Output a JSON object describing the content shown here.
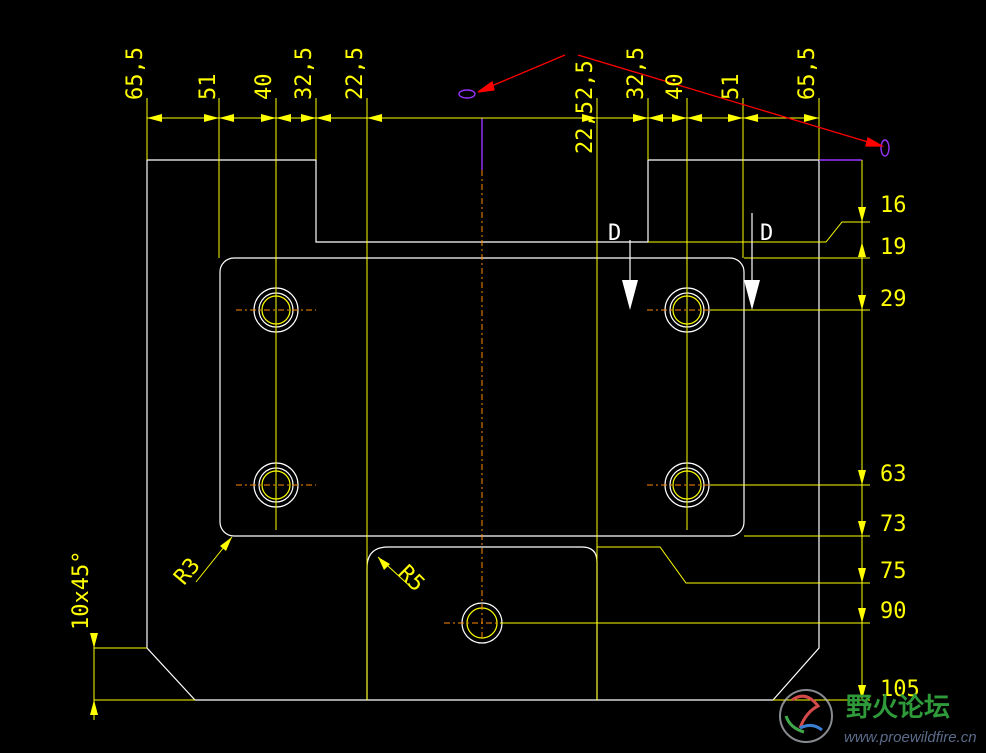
{
  "top_dimensions_left": [
    "65,5",
    "51",
    "40",
    "32,5",
    "22,5"
  ],
  "top_dimensions_right": [
    "2,5",
    "22,5",
    "32,5",
    "40",
    "51",
    "65,5"
  ],
  "right_dimensions": [
    "16",
    "19",
    "29",
    "63",
    "73",
    "75",
    "90",
    "105"
  ],
  "section_labels": [
    "D",
    "D"
  ],
  "radius_labels": [
    "R3",
    "R5"
  ],
  "chamfer_label": "10x45°",
  "watermark": {
    "name": "野火论坛",
    "url": "www.proewildfire.cn"
  },
  "colors": {
    "background": "#000000",
    "geometry": "#ffffff",
    "dimension": "#ffff00",
    "centerline": "#ff8c00",
    "marker": "#9933ff",
    "leader": "#ff0000"
  }
}
